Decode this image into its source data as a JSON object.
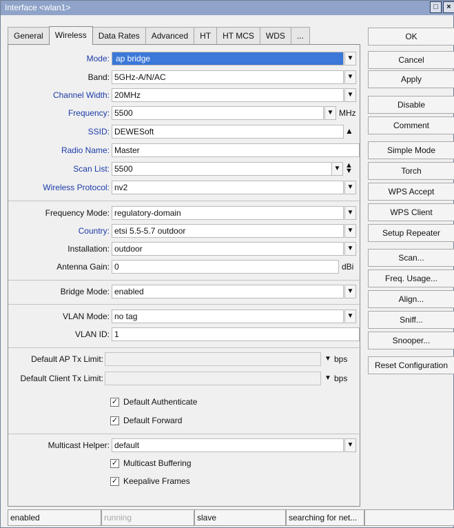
{
  "window": {
    "title": "Interface <wlan1>"
  },
  "tabs": [
    {
      "label": "General"
    },
    {
      "label": "Wireless"
    },
    {
      "label": "Data Rates"
    },
    {
      "label": "Advanced"
    },
    {
      "label": "HT"
    },
    {
      "label": "HT MCS"
    },
    {
      "label": "WDS"
    },
    {
      "label": "..."
    }
  ],
  "form": {
    "mode": {
      "label": "Mode:",
      "value": "ap bridge"
    },
    "band": {
      "label": "Band:",
      "value": "5GHz-A/N/AC"
    },
    "channel_width": {
      "label": "Channel Width:",
      "value": "20MHz"
    },
    "frequency": {
      "label": "Frequency:",
      "value": "5500",
      "unit": "MHz"
    },
    "ssid": {
      "label": "SSID:",
      "value": "DEWESoft"
    },
    "radio_name": {
      "label": "Radio Name:",
      "value": "Master"
    },
    "scan_list": {
      "label": "Scan List:",
      "value": "5500"
    },
    "wireless_protocol": {
      "label": "Wireless Protocol:",
      "value": "nv2"
    },
    "frequency_mode": {
      "label": "Frequency Mode:",
      "value": "regulatory-domain"
    },
    "country": {
      "label": "Country:",
      "value": "etsi 5.5-5.7 outdoor"
    },
    "installation": {
      "label": "Installation:",
      "value": "outdoor"
    },
    "antenna_gain": {
      "label": "Antenna Gain:",
      "value": "0",
      "unit": "dBi"
    },
    "bridge_mode": {
      "label": "Bridge Mode:",
      "value": "enabled"
    },
    "vlan_mode": {
      "label": "VLAN Mode:",
      "value": "no tag"
    },
    "vlan_id": {
      "label": "VLAN ID:",
      "value": "1"
    },
    "default_ap_tx_limit": {
      "label": "Default AP Tx Limit:",
      "value": "",
      "unit": "bps"
    },
    "default_client_tx_limit": {
      "label": "Default Client Tx Limit:",
      "value": "",
      "unit": "bps"
    },
    "default_authenticate": {
      "label": "Default Authenticate",
      "checked": true
    },
    "default_forward": {
      "label": "Default Forward",
      "checked": true
    },
    "multicast_helper": {
      "label": "Multicast Helper:",
      "value": "default"
    },
    "multicast_buffering": {
      "label": "Multicast Buffering",
      "checked": true
    },
    "keepalive_frames": {
      "label": "Keepalive Frames",
      "checked": true
    }
  },
  "side_buttons": [
    {
      "label": "OK"
    },
    {
      "label": "Cancel"
    },
    {
      "label": "Apply"
    },
    {
      "label": "Disable"
    },
    {
      "label": "Comment"
    },
    {
      "label": "Simple Mode"
    },
    {
      "label": "Torch"
    },
    {
      "label": "WPS Accept"
    },
    {
      "label": "WPS Client"
    },
    {
      "label": "Setup Repeater"
    },
    {
      "label": "Scan..."
    },
    {
      "label": "Freq. Usage..."
    },
    {
      "label": "Align..."
    },
    {
      "label": "Sniff..."
    },
    {
      "label": "Snooper..."
    },
    {
      "label": "Reset Configuration"
    }
  ],
  "status_bar": [
    {
      "text": "enabled"
    },
    {
      "text": "running"
    },
    {
      "text": "slave"
    },
    {
      "text": "searching for net..."
    },
    {
      "text": ""
    }
  ],
  "icons": {
    "dropdown": "dropdown-arrow-icon",
    "spin_up": "spin-up-icon",
    "spin_updown": "spin-updown-icon",
    "restore": "restore-icon",
    "close": "close-icon"
  },
  "colors": {
    "title_bar": "#90a4c9",
    "link_label": "#1a3aa8",
    "selection": "#3b78d8"
  }
}
